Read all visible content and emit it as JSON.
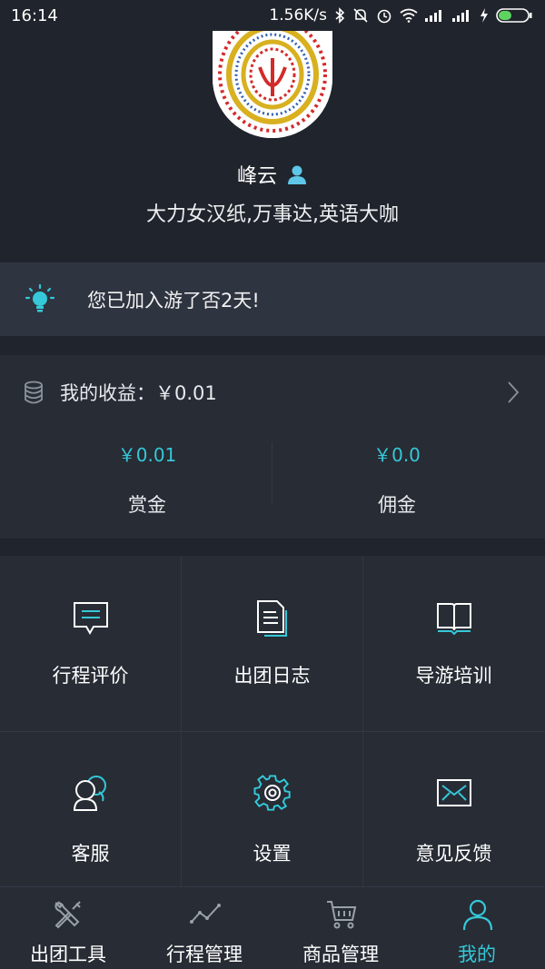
{
  "status_bar": {
    "time": "16:14",
    "network_speed": "1.56K/s"
  },
  "profile": {
    "name": "峰云",
    "bio": "大力女汉纸,万事达,英语大咖"
  },
  "tip": {
    "text": "您已加入游了否2天!"
  },
  "earnings": {
    "title": "我的收益：￥0.01",
    "items": [
      {
        "amount": "￥0.01",
        "label": "赏金"
      },
      {
        "amount": "￥0.0",
        "label": "佣金"
      }
    ]
  },
  "menu": [
    {
      "label": "行程评价",
      "icon": "comment-icon"
    },
    {
      "label": "出团日志",
      "icon": "document-icon"
    },
    {
      "label": "导游培训",
      "icon": "book-icon"
    },
    {
      "label": "客服",
      "icon": "customer-service-icon"
    },
    {
      "label": "设置",
      "icon": "gear-icon"
    },
    {
      "label": "意见反馈",
      "icon": "envelope-icon"
    }
  ],
  "tabbar": [
    {
      "label": "出团工具",
      "icon": "tools-icon",
      "active": false
    },
    {
      "label": "行程管理",
      "icon": "trend-icon",
      "active": false
    },
    {
      "label": "商品管理",
      "icon": "cart-icon",
      "active": false
    },
    {
      "label": "我的",
      "icon": "person-icon",
      "active": true
    }
  ],
  "colors": {
    "background": "#20242c",
    "panel": "#272c35",
    "tip_bar": "#2e3440",
    "accent": "#35c8d8"
  }
}
